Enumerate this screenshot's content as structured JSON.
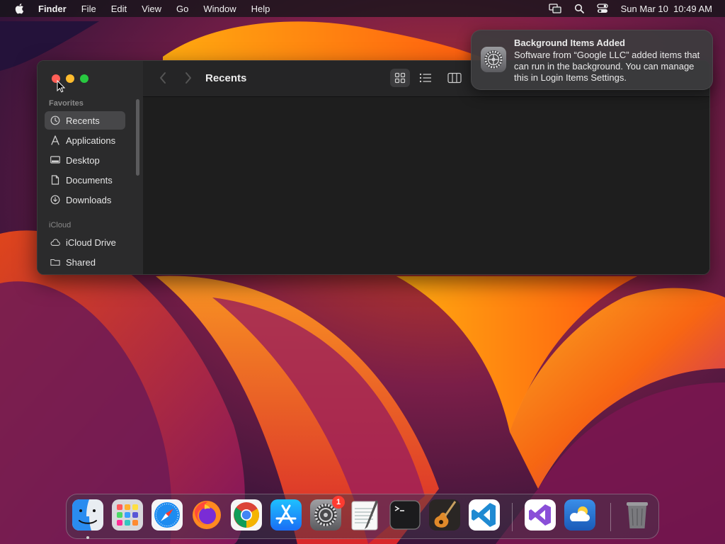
{
  "menubar": {
    "app_name": "Finder",
    "items": [
      "File",
      "Edit",
      "View",
      "Go",
      "Window",
      "Help"
    ],
    "datetime": "Sun Mar 10  10:49 AM"
  },
  "finder": {
    "title": "Recents",
    "sidebar": {
      "favorites_header": "Favorites",
      "favorites": [
        {
          "label": "Recents",
          "icon": "clock-icon",
          "selected": true
        },
        {
          "label": "Applications",
          "icon": "applications-icon"
        },
        {
          "label": "Desktop",
          "icon": "desktop-icon"
        },
        {
          "label": "Documents",
          "icon": "document-icon"
        },
        {
          "label": "Downloads",
          "icon": "download-icon"
        }
      ],
      "icloud_header": "iCloud",
      "icloud": [
        {
          "label": "iCloud Drive",
          "icon": "cloud-icon"
        },
        {
          "label": "Shared",
          "icon": "shared-folder-icon"
        }
      ]
    }
  },
  "notification": {
    "title": "Background Items Added",
    "body": "Software from “Google LLC” added items that can run in the background. You can manage this in Login Items Settings."
  },
  "dock": {
    "apps": [
      "finder",
      "launchpad",
      "safari",
      "firefox",
      "chrome",
      "app-store",
      "system-settings",
      "textedit",
      "terminal",
      "garageband",
      "vscode",
      "visual-studio",
      "weather",
      "trash"
    ],
    "settings_badge": "1"
  },
  "colors": {
    "close": "#ff5f57",
    "minimize": "#febc2e",
    "maximize": "#28c840",
    "badge": "#ff3b30"
  }
}
